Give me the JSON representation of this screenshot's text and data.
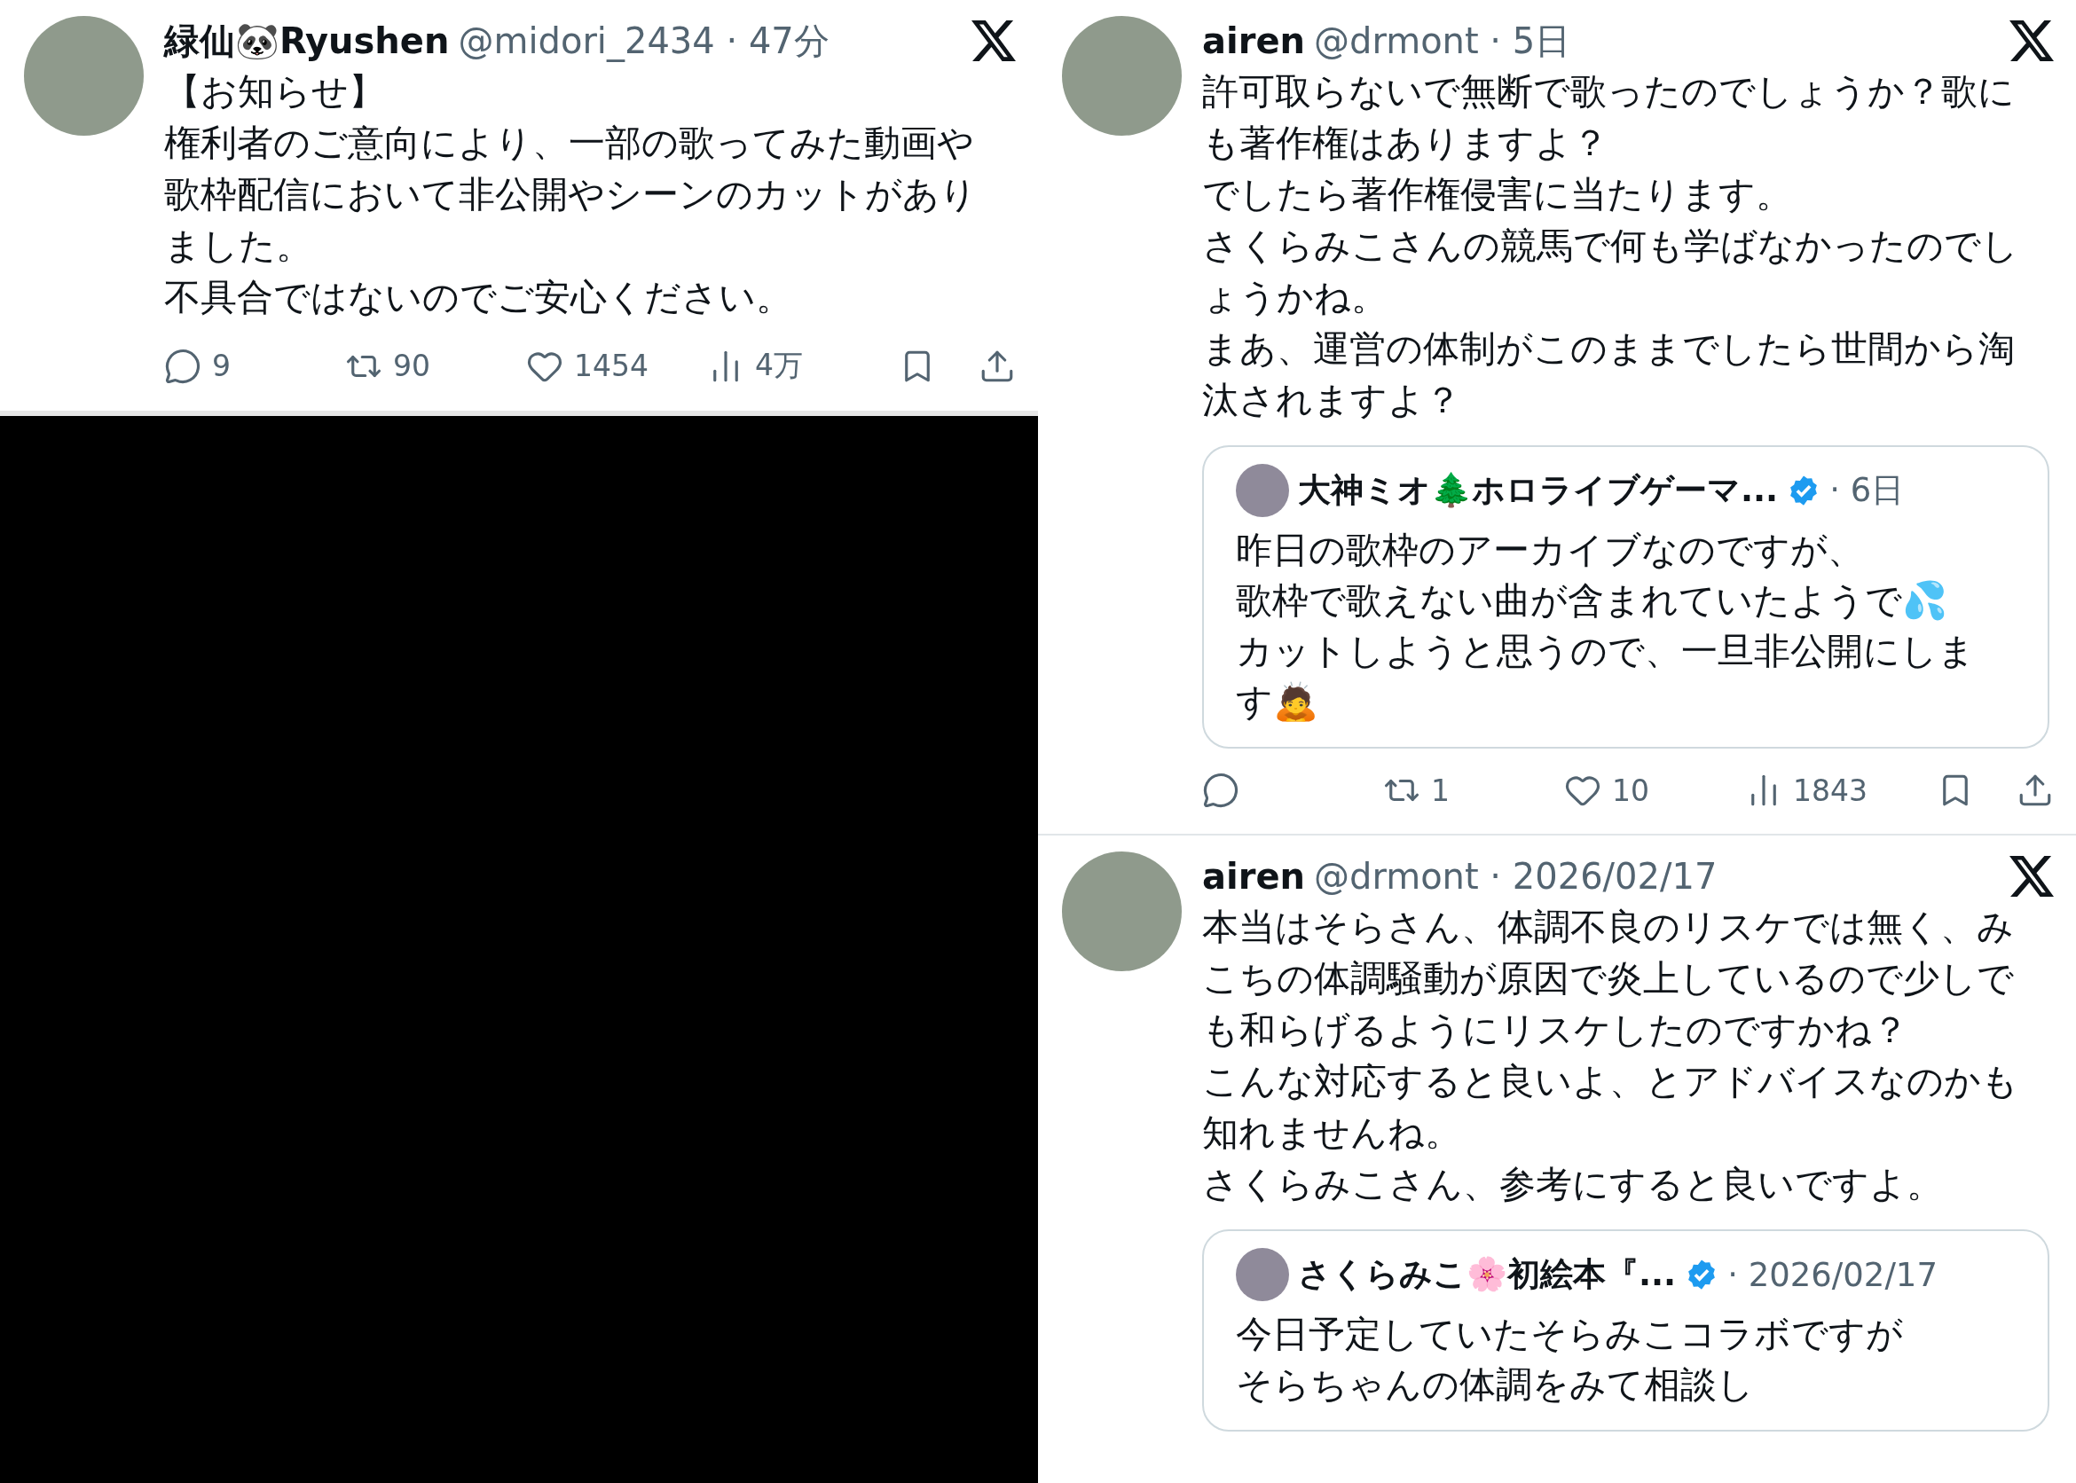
{
  "left_column": {
    "posts": [
      {
        "author": {
          "name": "緑仙🐼Ryushen",
          "meta": "@midori_2434 · 47分"
        },
        "body": [
          "【お知らせ】",
          "権利者のご意向により、一部の歌ってみた動画や歌枠配信において非公開やシーンのカットがありました。",
          "不具合ではないのでご安心ください。"
        ],
        "actions": {
          "replies": "9",
          "reposts": "90",
          "likes": "1454",
          "views": "4万"
        }
      }
    ]
  },
  "right_column": {
    "posts": [
      {
        "author": {
          "name": "airen",
          "meta": "@drmont · 5日"
        },
        "body": [
          "許可取らないで無断で歌ったのでしょうか？歌にも著作権はありますよ？",
          "でしたら著作権侵害に当たります。",
          "さくらみこさんの競馬で何も学ばなかったのでしょうかね。",
          "まあ、運営の体制がこのままでしたら世間から淘汰されますよ？"
        ],
        "quote": {
          "author": {
            "name": "大神ミオ🌲ホロライブゲーマ...",
            "meta": "· 6日",
            "verified": true
          },
          "body": [
            "昨日の歌枠のアーカイブなのですが、",
            "歌枠で歌えない曲が含まれていたようで💦",
            "カットしようと思うので、一旦非公開にします🙇"
          ]
        },
        "actions": {
          "reposts": "1",
          "likes": "10",
          "views": "1843"
        }
      },
      {
        "author": {
          "name": "airen",
          "meta": "@drmont · 2026/02/17"
        },
        "body": [
          "本当はそらさん、体調不良のリスケでは無く、みこちの体調騒動が原因で炎上しているので少しでも和らげるようにリスケしたのですかね？",
          "こんな対応すると良いよ、とアドバイスなのかも知れませんね。",
          "さくらみこさん、参考にすると良いですよ。"
        ],
        "quote": {
          "author": {
            "name": "さくらみこ🌸初絵本『...",
            "meta": "· 2026/02/17",
            "verified": true
          },
          "body": [
            "今日予定していたそらみこコラボですが",
            "そらちゃんの体調をみて相談し"
          ]
        }
      }
    ]
  }
}
